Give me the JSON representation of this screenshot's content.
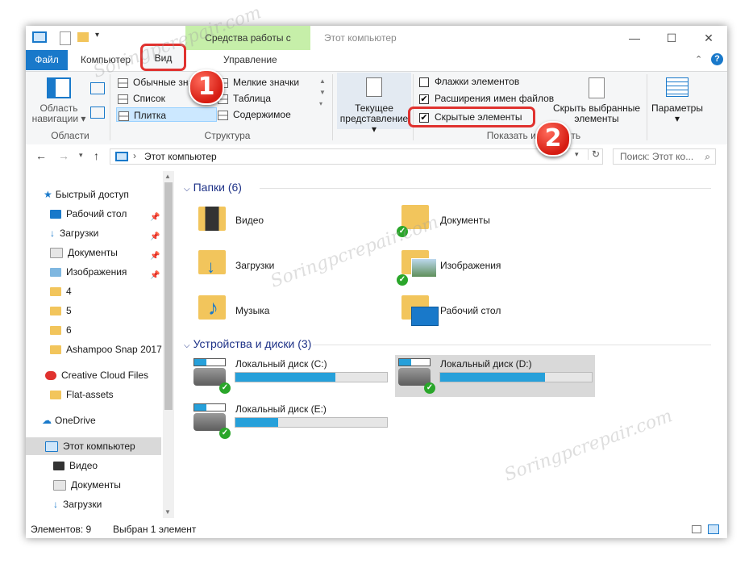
{
  "window": {
    "title": "Этот компьютер",
    "context_tab": "Средства работы с дисками",
    "controls": {
      "minimize": "—",
      "maximize": "☐",
      "close": "✕"
    }
  },
  "tabs": {
    "file": "Файл",
    "computer": "Компьютер",
    "view": "Вид",
    "manage": "Управление"
  },
  "ribbon": {
    "panes": {
      "nav_pane_line1": "Область",
      "nav_pane_line2": "навигации",
      "group": "Области"
    },
    "layout": {
      "items": [
        "Обычные значки",
        "Список",
        "Плитка",
        "Мелкие значки",
        "Таблица",
        "Содержимое"
      ],
      "group": "Структура"
    },
    "current_view": {
      "line1": "Текущее",
      "line2": "представление"
    },
    "show_hide": {
      "checkboxes": [
        {
          "label": "Флажки элементов",
          "checked": false
        },
        {
          "label": "Расширения имен файлов",
          "checked": true
        },
        {
          "label": "Скрытые элементы",
          "checked": true
        }
      ],
      "hide_selected_line1": "Скрыть выбранные",
      "hide_selected_line2": "элементы",
      "group": "Показать или скрыть"
    },
    "options": "Параметры"
  },
  "address": {
    "path": "Этот компьютер",
    "search_placeholder": "Поиск: Этот ко..."
  },
  "nav_pane": {
    "items": [
      "Быстрый доступ",
      "Рабочий стол",
      "Загрузки",
      "Документы",
      "Изображения",
      "4",
      "5",
      "6",
      "Ashampoo Snap 2017",
      "Creative Cloud Files",
      "Flat-assets",
      "OneDrive",
      "Этот компьютер",
      "Видео",
      "Документы",
      "Загрузки"
    ]
  },
  "content": {
    "folders_header": "Папки (6)",
    "folders": [
      "Видео",
      "Документы",
      "Загрузки",
      "Изображения",
      "Музыка",
      "Рабочий стол"
    ],
    "drives_header": "Устройства и диски (3)",
    "drives": [
      {
        "name": "Локальный диск (C:)",
        "used_fraction": 0.66
      },
      {
        "name": "Локальный диск (D:)",
        "used_fraction": 0.69
      },
      {
        "name": "Локальный диск (E:)",
        "used_fraction": 0.28
      }
    ]
  },
  "status": {
    "count": "Элементов: 9",
    "selected": "Выбран 1 элемент"
  },
  "annotations": {
    "badge1": "1",
    "badge2": "2"
  },
  "watermark": "Soringpcrepair.com",
  "colors": {
    "accent": "#1979ca",
    "highlight": "#e0322f",
    "context_tab": "#c6efa9",
    "drive_bar": "#26a0da"
  }
}
